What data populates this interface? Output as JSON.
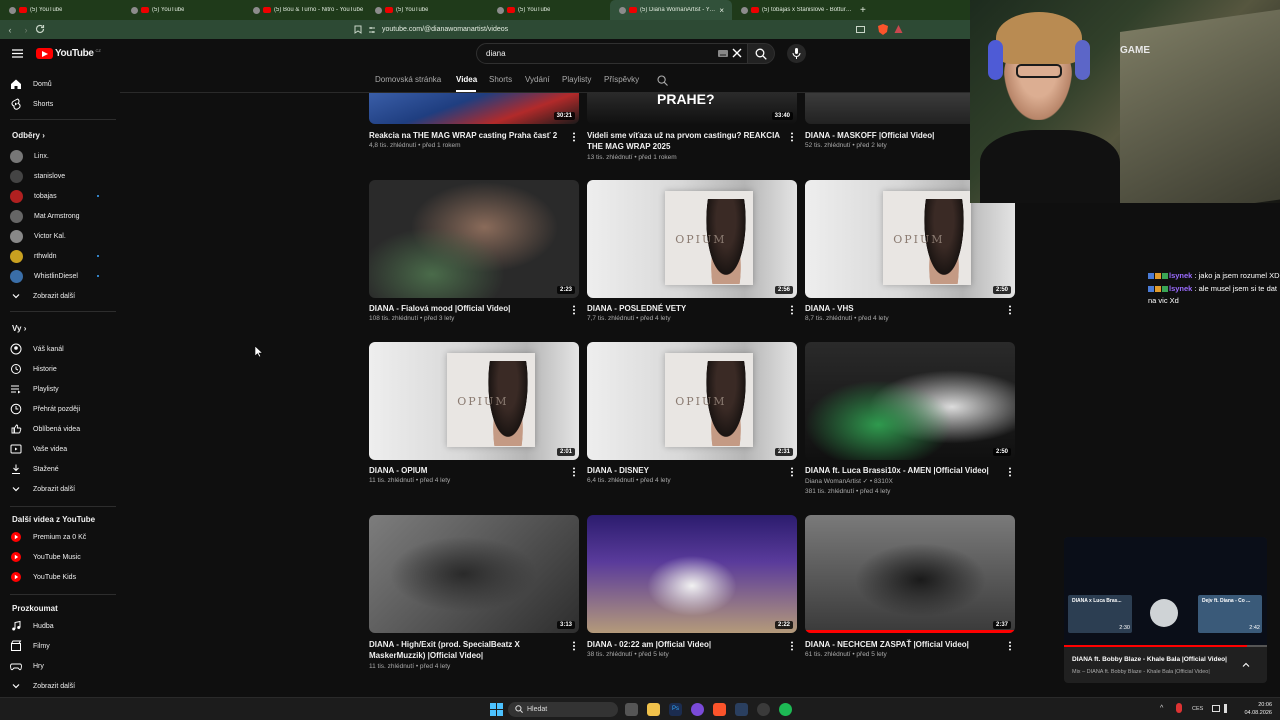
{
  "browser": {
    "tabs": [
      {
        "label": "(5) YouTube",
        "active": false
      },
      {
        "label": "(5) YouTube",
        "active": false
      },
      {
        "label": "(5) Bou & Turno - Nitro - YouTube",
        "active": false
      },
      {
        "label": "(5) YouTube",
        "active": false
      },
      {
        "label": "(5) YouTube",
        "active": false
      },
      {
        "label": "(5) Diana WomanArtist - YouTube",
        "active": true
      },
      {
        "label": "(5) tobajas x Stanislove - Bottura ft. L",
        "active": false
      }
    ],
    "url": "youtube.com/@dianawomanartist/videos",
    "theme_color": "#1f3a1a"
  },
  "yt": {
    "logo_text": "YouTube",
    "logo_region": "CZ",
    "search_value": "diana",
    "brand_red": "#ff0000"
  },
  "channel_tabs": [
    "Domovská stránka",
    "Videa",
    "Shorts",
    "Vydání",
    "Playlisty",
    "Příspěvky"
  ],
  "channel_tab_selected": "Videa",
  "sidebar": {
    "home": "Domů",
    "shorts": "Shorts",
    "subs_header": "Odběry",
    "subs": [
      {
        "name": "Linx.",
        "dot": false
      },
      {
        "name": "stanislove",
        "dot": false
      },
      {
        "name": "tobajas",
        "dot": true
      },
      {
        "name": "Mat Armstrong",
        "dot": false
      },
      {
        "name": "Victor Kal.",
        "dot": false
      },
      {
        "name": "rthwldn",
        "dot": true
      },
      {
        "name": "WhistlinDiesel",
        "dot": true
      }
    ],
    "subs_more": "Zobrazit další",
    "you_header": "Vy",
    "you_items": [
      "Váš kanál",
      "Historie",
      "Playlisty",
      "Přehrát později",
      "Oblíbená videa",
      "Vaše videa",
      "Stažené",
      "Zobrazit další"
    ],
    "more_header": "Další videa z YouTube",
    "more_items": [
      "Premium za 0 Kč",
      "YouTube Music",
      "YouTube Kids"
    ],
    "explore_header": "Prozkoumat",
    "explore_items": [
      "Hudba",
      "Filmy",
      "Hry",
      "Zobrazit další"
    ]
  },
  "videos": [
    {
      "title": "Reakcia na THE MAG WRAP casting Praha časť 2",
      "meta1": "4,8 tis. zhlédnutí • před 1 rokem",
      "meta2": "",
      "duration": "30:21"
    },
    {
      "title": "Videli sme víťaza už na prvom castingu? REAKCIA THE MAG WRAP 2025",
      "meta1": "13 tis. zhlédnutí • před 1 rokem",
      "meta2": "",
      "duration": "33:40",
      "thumb_text": "PRAHE?"
    },
    {
      "title": "DIANA - MASKOFF |Official Video|",
      "meta1": "52 tis. zhlédnutí • před 2 lety",
      "meta2": "",
      "duration": ""
    },
    {
      "title": "DIANA - Fialová mood |Official Video|",
      "meta1": "108 tis. zhlédnutí • před 3 lety",
      "meta2": "",
      "duration": "2:23"
    },
    {
      "title": "DIANA - POSLEDNÉ VETY",
      "meta1": "7,7 tis. zhlédnutí • před 4 lety",
      "meta2": "",
      "duration": "2:56",
      "thumb_text": "OPIUM"
    },
    {
      "title": "DIANA - VHS",
      "meta1": "8,7 tis. zhlédnutí • před 4 lety",
      "meta2": "",
      "duration": "2:50",
      "thumb_text": "OPIUM"
    },
    {
      "title": "DIANA - OPIUM",
      "meta1": "11 tis. zhlédnutí • před 4 lety",
      "meta2": "",
      "duration": "2:01",
      "thumb_text": "OPIUM"
    },
    {
      "title": "DIANA - DISNEY",
      "meta1": "6,4 tis. zhlédnutí • před 4 lety",
      "meta2": "",
      "duration": "2:31",
      "thumb_text": "OPIUM"
    },
    {
      "title": "DIANA ft. Luca Brassi10x - AMEN |Official Video|",
      "meta1": "Diana WomanArtist ✓ • 8310X",
      "meta2": "381 tis. zhlédnutí • před 4 lety",
      "duration": "2:50"
    },
    {
      "title": "DIANA - High/Exit (prod. SpecialBeatz X MaskerMuzzik) |Official Video|",
      "meta1": "11 tis. zhlédnutí • před 4 lety",
      "meta2": "",
      "duration": "3:13"
    },
    {
      "title": "DIANA - 02:22 am |Official Video|",
      "meta1": "38 tis. zhlédnutí • před 5 lety",
      "meta2": "",
      "duration": "2:22"
    },
    {
      "title": "DIANA - NECHCEM ZASPAŤ |Official Video|",
      "meta1": "61 tis. zhlédnutí • před 5 lety",
      "meta2": "",
      "duration": "2:37"
    }
  ],
  "overlay": {
    "cam_text": "GAME",
    "chat": [
      {
        "user": "lsynek",
        "text": "jako ja jsem rozumel XD"
      },
      {
        "user": "lsynek",
        "text": "ale musel jsem si te dat na vic Xd"
      }
    ],
    "mini": {
      "title": "DIANA ft. Bobby Blaze - Khale Bala |Official Video|",
      "subtitle": "Mix – DIANA ft. Bobby Blaze - Khale Bala |Official Video|",
      "left_label": "DIANA x Luca Bras...",
      "left_time": "2:30",
      "right_label": "Dejv ft. Diana - Co ...",
      "right_time": "2:42"
    }
  },
  "taskbar": {
    "search": "Hledat",
    "lang": "CES",
    "time": "20:06",
    "date": "04.08.2026"
  }
}
